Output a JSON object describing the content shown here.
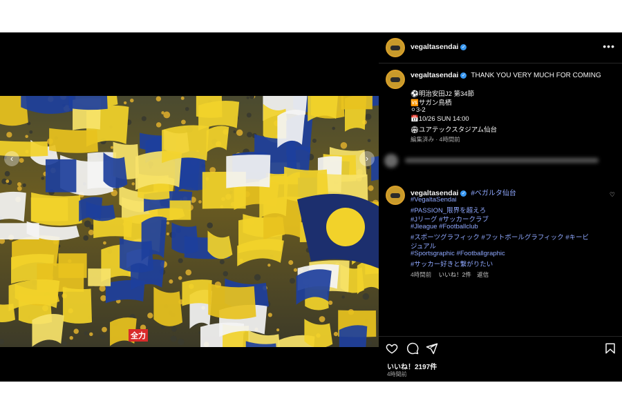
{
  "post": {
    "username": "vegaltasendai",
    "caption_title": "THANK YOU VERY MUCH FOR COMING",
    "caption_lines": [
      "⚽明治安田J2 第34節",
      "🆚サガン鳥栖",
      "⚪3-2",
      "📅10/26 SUN 14:00",
      "🏟ユアテックスタジアム仙台"
    ],
    "caption_meta": "編集済み · 4時間前",
    "comment": {
      "username": "vegaltasendai",
      "first_tag": "#ベガルタ仙台",
      "tags": [
        "#VegaltaSendai",
        "#PASSION_限界を超えろ",
        "#Jリーグ #サッカークラブ",
        "#Jleague #Footballclub",
        "#スポーツグラフィック #フットボールグラフィック #キービ",
        "ジュアル",
        "#Sportsgraphic #Footballgraphic",
        "#サッカー好きと繋がりたい"
      ],
      "meta_time": "4時間前",
      "meta_likes": "いいね！2件",
      "meta_reply": "返信"
    },
    "likes": "いいね！2197件",
    "posted_ago": "4時間前"
  },
  "photo": {
    "banner_text": "全力",
    "colors": {
      "yellow": "#f2d22a",
      "blue": "#1d3f9c",
      "white": "#f4f4f4"
    }
  },
  "icons": [
    "more-options-icon",
    "heart-icon",
    "comment-icon",
    "share-icon",
    "bookmark-icon",
    "verified-icon"
  ]
}
